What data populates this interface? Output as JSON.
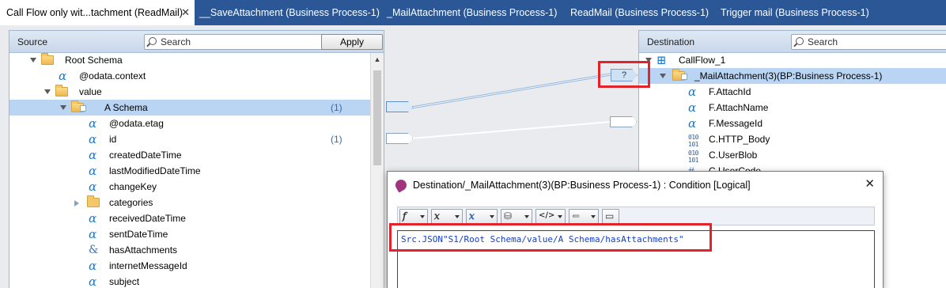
{
  "tabs": [
    {
      "label": "Call Flow only wit...tachment (ReadMail)",
      "active": true
    },
    {
      "label": "__SaveAttachment (Business Process-1)"
    },
    {
      "label": "_MailAttachment (Business Process-1)"
    },
    {
      "label": "ReadMail (Business Process-1)"
    },
    {
      "label": "Trigger mail (Business Process-1)"
    }
  ],
  "source": {
    "title": "Source",
    "search_placeholder": "Search",
    "apply_label": "Apply",
    "rows": [
      {
        "label": "Root Schema",
        "icon": "folder-open",
        "expander": "down"
      },
      {
        "label": "@odata.context",
        "icon": "alpha"
      },
      {
        "label": "value",
        "icon": "folder-open",
        "expander": "down"
      },
      {
        "label": "A Schema",
        "icon": "folder-doc",
        "expander": "down",
        "count": "(1)",
        "selected": true
      },
      {
        "label": "@odata.etag",
        "icon": "alpha"
      },
      {
        "label": "id",
        "icon": "alpha",
        "count": "(1)"
      },
      {
        "label": "createdDateTime",
        "icon": "alpha"
      },
      {
        "label": "lastModifiedDateTime",
        "icon": "alpha"
      },
      {
        "label": "changeKey",
        "icon": "alpha"
      },
      {
        "label": "categories",
        "icon": "folder",
        "expander": "right"
      },
      {
        "label": "receivedDateTime",
        "icon": "alpha"
      },
      {
        "label": "sentDateTime",
        "icon": "alpha"
      },
      {
        "label": "hasAttachments",
        "icon": "ampersand"
      },
      {
        "label": "internetMessageId",
        "icon": "alpha"
      },
      {
        "label": "subject",
        "icon": "alpha"
      }
    ]
  },
  "destination": {
    "title": "Destination",
    "search_placeholder": "Search",
    "rows": [
      {
        "label": "CallFlow_1",
        "icon": "network",
        "expander": "down"
      },
      {
        "label": "_MailAttachment(3)(BP:Business Process-1)",
        "icon": "folder-doc",
        "expander": "down",
        "selected": true
      },
      {
        "label": "F.AttachId",
        "icon": "alpha"
      },
      {
        "label": "F.AttachName",
        "icon": "alpha"
      },
      {
        "label": "F.MessageId",
        "icon": "alpha"
      },
      {
        "label": "C.HTTP_Body",
        "icon": "binary"
      },
      {
        "label": "C.UserBlob",
        "icon": "binary"
      },
      {
        "label": "C.UserCode",
        "icon": "hash"
      }
    ]
  },
  "connector_condition_label": "?",
  "dialog": {
    "title": "Destination/_MailAttachment(3)(BP:Business Process-1) : Condition [Logical]",
    "expression": "Src.JSON\"S1/Root Schema/value/A Schema/hasAttachments\""
  }
}
